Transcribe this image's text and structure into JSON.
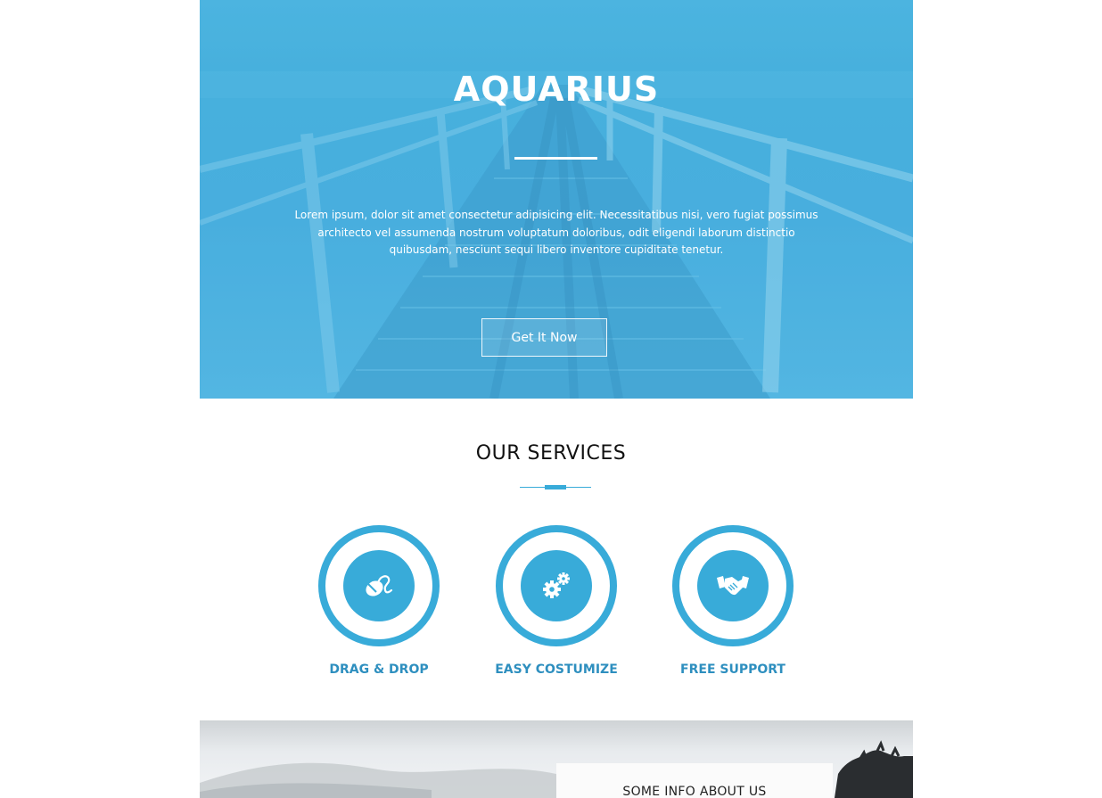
{
  "hero": {
    "title": "AQUARIUS",
    "text": "Lorem ipsum, dolor sit amet consectetur adipisicing elit. Necessitatibus nisi, vero fugiat possimus architecto vel assumenda nostrum voluptatum doloribus, odit eligendi laborum distinctio quibusdam, nesciunt sequi libero inventore cupiditate tenetur.",
    "button_label": "Get It Now"
  },
  "services": {
    "title": "OUR SERVICES",
    "items": [
      {
        "label": "DRAG & DROP",
        "icon": "mouse-icon"
      },
      {
        "label": "EASY COSTUMIZE",
        "icon": "gears-icon"
      },
      {
        "label": "FREE SUPPORT",
        "icon": "handshake-icon"
      }
    ]
  },
  "about": {
    "title": "SOME INFO ABOUT US"
  },
  "colors": {
    "accent": "#38abd9",
    "label": "#2e8fbf"
  }
}
